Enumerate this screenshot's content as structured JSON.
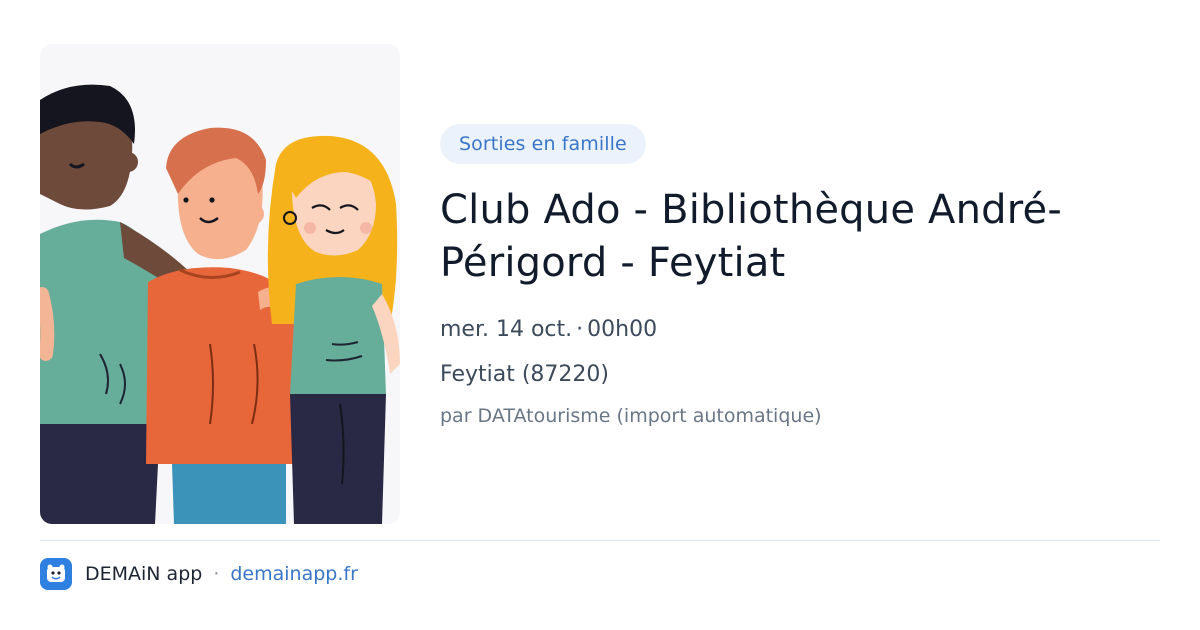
{
  "event": {
    "category_tag": "Sorties en famille",
    "title": "Club Ado - Bibliothèque André-Périgord - Feytiat",
    "date": "mer. 14 oct.",
    "date_separator": "·",
    "time": "00h00",
    "location": "Feytiat (87220)",
    "source": "par DATAtourisme (import automatique)"
  },
  "footer": {
    "app_name": "DEMAiN app",
    "separator": "·",
    "site": "demainapp.fr"
  },
  "colors": {
    "accent": "#3a76c8",
    "tag_background": "#ecf2fb",
    "logo_background": "#2f7fe0",
    "title": "#111b2b"
  },
  "icons": {
    "app_logo": "demain-app-logo-icon"
  }
}
